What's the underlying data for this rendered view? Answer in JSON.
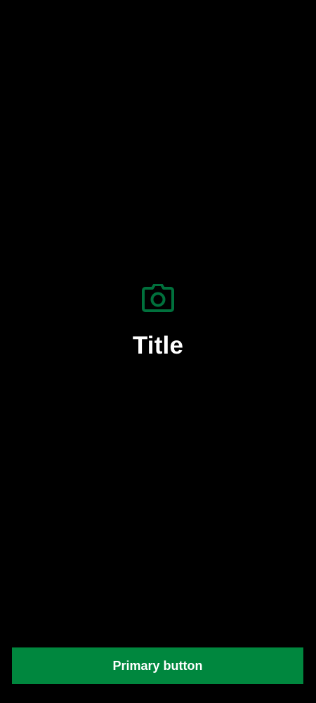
{
  "screen": {
    "title": "Title",
    "icon": "camera-icon"
  },
  "actions": {
    "primary_label": "Primary button"
  },
  "colors": {
    "background": "#000000",
    "accent": "#00703c",
    "button": "#00873e",
    "text": "#ffffff"
  }
}
